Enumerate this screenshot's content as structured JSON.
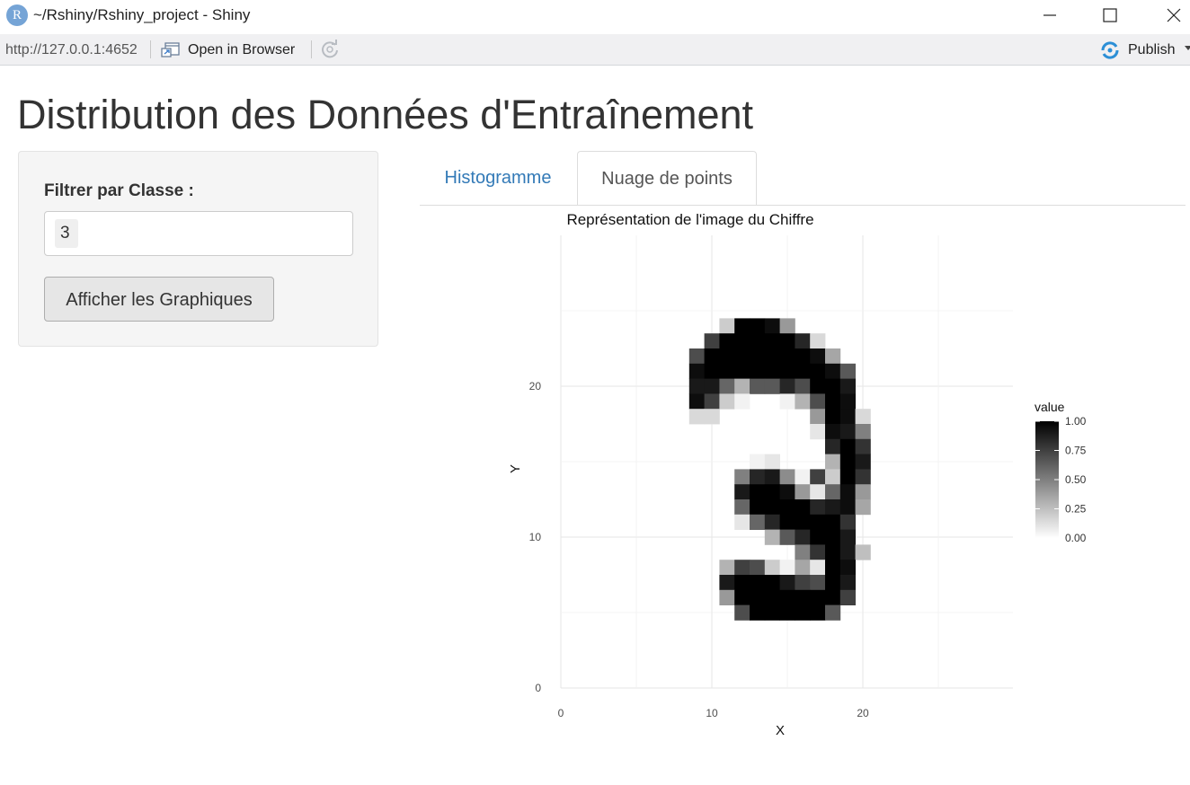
{
  "window": {
    "app_icon": "R",
    "title": "~/Rshiny/Rshiny_project - Shiny",
    "controls": [
      "minimize-icon",
      "maximize-icon",
      "close-icon"
    ]
  },
  "toolbar": {
    "url": "http://127.0.0.1:4652",
    "open_in_browser": "Open in Browser",
    "publish": "Publish",
    "icons": [
      "open-in-browser-icon",
      "refresh-icon",
      "publish-icon"
    ]
  },
  "page": {
    "title": "Distribution des Données d'Entraînement"
  },
  "sidebar": {
    "filter_label": "Filtrer par Classe :",
    "selected_class": "3",
    "button_label": "Afficher les Graphiques"
  },
  "tabs": [
    {
      "label": "Histogramme",
      "active": false
    },
    {
      "label": "Nuage de points",
      "active": true
    }
  ],
  "colors": {
    "tab_link": "#337ab7",
    "well_bg": "#f5f5f5",
    "button_bg": "#e6e6e6",
    "heat_low": "#ffffff",
    "heat_high": "#000000"
  },
  "chart_data": {
    "type": "heatmap",
    "title": "Représentation de l'image du Chiffre",
    "xlabel": "X",
    "ylabel": "Y",
    "xlim": [
      0,
      30
    ],
    "ylim": [
      0,
      30
    ],
    "x_ticks": [
      0,
      10,
      20
    ],
    "y_ticks": [
      0,
      10,
      20
    ],
    "grid": true,
    "legend": {
      "title": "value",
      "position": "right",
      "ticks": [
        "1.00",
        "0.75",
        "0.50",
        "0.25",
        "0.00"
      ],
      "range": [
        0,
        1
      ]
    },
    "cells": [
      [
        11,
        24,
        0.2
      ],
      [
        12,
        24,
        1
      ],
      [
        13,
        24,
        1
      ],
      [
        14,
        24,
        0.95
      ],
      [
        15,
        24,
        0.4
      ],
      [
        10,
        23,
        0.75
      ],
      [
        11,
        23,
        1
      ],
      [
        12,
        23,
        1
      ],
      [
        13,
        23,
        1
      ],
      [
        14,
        23,
        1
      ],
      [
        15,
        23,
        1
      ],
      [
        16,
        23,
        0.85
      ],
      [
        17,
        23,
        0.15
      ],
      [
        9,
        22,
        0.7
      ],
      [
        10,
        22,
        1
      ],
      [
        11,
        22,
        1
      ],
      [
        12,
        22,
        1
      ],
      [
        13,
        22,
        1
      ],
      [
        14,
        22,
        1
      ],
      [
        15,
        22,
        1
      ],
      [
        16,
        22,
        1
      ],
      [
        17,
        22,
        0.95
      ],
      [
        18,
        22,
        0.35
      ],
      [
        9,
        21,
        0.95
      ],
      [
        10,
        21,
        1
      ],
      [
        11,
        21,
        1
      ],
      [
        12,
        21,
        1
      ],
      [
        13,
        21,
        1
      ],
      [
        14,
        21,
        1
      ],
      [
        15,
        21,
        1
      ],
      [
        16,
        21,
        1
      ],
      [
        17,
        21,
        1
      ],
      [
        18,
        21,
        0.95
      ],
      [
        19,
        21,
        0.65
      ],
      [
        9,
        20,
        0.9
      ],
      [
        10,
        20,
        0.9
      ],
      [
        11,
        20,
        0.6
      ],
      [
        12,
        20,
        0.3
      ],
      [
        13,
        20,
        0.65
      ],
      [
        14,
        20,
        0.65
      ],
      [
        15,
        20,
        0.85
      ],
      [
        16,
        20,
        0.7
      ],
      [
        17,
        20,
        1
      ],
      [
        18,
        20,
        1
      ],
      [
        19,
        20,
        0.9
      ],
      [
        9,
        19,
        0.95
      ],
      [
        10,
        19,
        0.75
      ],
      [
        11,
        19,
        0.2
      ],
      [
        12,
        19,
        0.05
      ],
      [
        15,
        19,
        0.05
      ],
      [
        16,
        19,
        0.3
      ],
      [
        17,
        19,
        0.7
      ],
      [
        18,
        19,
        1
      ],
      [
        19,
        19,
        0.95
      ],
      [
        9,
        18,
        0.15
      ],
      [
        10,
        18,
        0.15
      ],
      [
        17,
        18,
        0.4
      ],
      [
        18,
        18,
        1
      ],
      [
        19,
        18,
        0.95
      ],
      [
        20,
        18,
        0.15
      ],
      [
        17,
        17,
        0.1
      ],
      [
        18,
        17,
        0.95
      ],
      [
        19,
        17,
        0.9
      ],
      [
        20,
        17,
        0.5
      ],
      [
        18,
        16,
        0.85
      ],
      [
        19,
        16,
        1
      ],
      [
        20,
        16,
        0.8
      ],
      [
        13,
        15,
        0.05
      ],
      [
        14,
        15,
        0.1
      ],
      [
        18,
        15,
        0.3
      ],
      [
        19,
        15,
        1
      ],
      [
        20,
        15,
        0.9
      ],
      [
        12,
        14,
        0.5
      ],
      [
        13,
        14,
        0.85
      ],
      [
        14,
        14,
        0.9
      ],
      [
        15,
        14,
        0.45
      ],
      [
        16,
        14,
        0.05
      ],
      [
        17,
        14,
        0.75
      ],
      [
        18,
        14,
        0.2
      ],
      [
        19,
        14,
        1
      ],
      [
        20,
        14,
        0.8
      ],
      [
        12,
        13,
        0.9
      ],
      [
        13,
        13,
        1
      ],
      [
        14,
        13,
        1
      ],
      [
        15,
        13,
        0.95
      ],
      [
        16,
        13,
        0.4
      ],
      [
        17,
        13,
        0.1
      ],
      [
        18,
        13,
        0.6
      ],
      [
        19,
        13,
        0.95
      ],
      [
        20,
        13,
        0.4
      ],
      [
        12,
        12,
        0.6
      ],
      [
        13,
        12,
        1
      ],
      [
        14,
        12,
        1
      ],
      [
        15,
        12,
        1
      ],
      [
        16,
        12,
        1
      ],
      [
        17,
        12,
        0.85
      ],
      [
        18,
        12,
        0.9
      ],
      [
        19,
        12,
        0.95
      ],
      [
        20,
        12,
        0.35
      ],
      [
        12,
        11,
        0.1
      ],
      [
        13,
        11,
        0.6
      ],
      [
        14,
        11,
        0.85
      ],
      [
        15,
        11,
        1
      ],
      [
        16,
        11,
        1
      ],
      [
        17,
        11,
        1
      ],
      [
        18,
        11,
        1
      ],
      [
        19,
        11,
        0.8
      ],
      [
        14,
        10,
        0.3
      ],
      [
        15,
        10,
        0.65
      ],
      [
        16,
        10,
        0.85
      ],
      [
        17,
        10,
        1
      ],
      [
        18,
        10,
        1
      ],
      [
        19,
        10,
        0.9
      ],
      [
        16,
        9,
        0.5
      ],
      [
        17,
        9,
        0.8
      ],
      [
        18,
        9,
        1
      ],
      [
        19,
        9,
        0.9
      ],
      [
        20,
        9,
        0.25
      ],
      [
        11,
        8,
        0.3
      ],
      [
        12,
        8,
        0.75
      ],
      [
        13,
        8,
        0.7
      ],
      [
        14,
        8,
        0.2
      ],
      [
        15,
        8,
        0.05
      ],
      [
        16,
        8,
        0.35
      ],
      [
        17,
        8,
        0.1
      ],
      [
        18,
        8,
        1
      ],
      [
        19,
        8,
        0.95
      ],
      [
        11,
        7,
        0.9
      ],
      [
        12,
        7,
        1
      ],
      [
        13,
        7,
        1
      ],
      [
        14,
        7,
        1
      ],
      [
        15,
        7,
        0.9
      ],
      [
        16,
        7,
        0.75
      ],
      [
        17,
        7,
        0.7
      ],
      [
        18,
        7,
        1
      ],
      [
        19,
        7,
        0.9
      ],
      [
        11,
        6,
        0.4
      ],
      [
        12,
        6,
        1
      ],
      [
        13,
        6,
        1
      ],
      [
        14,
        6,
        1
      ],
      [
        15,
        6,
        1
      ],
      [
        16,
        6,
        1
      ],
      [
        17,
        6,
        1
      ],
      [
        18,
        6,
        1
      ],
      [
        19,
        6,
        0.75
      ],
      [
        12,
        5,
        0.7
      ],
      [
        13,
        5,
        1
      ],
      [
        14,
        5,
        1
      ],
      [
        15,
        5,
        1
      ],
      [
        16,
        5,
        1
      ],
      [
        17,
        5,
        1
      ],
      [
        18,
        5,
        0.65
      ]
    ]
  }
}
